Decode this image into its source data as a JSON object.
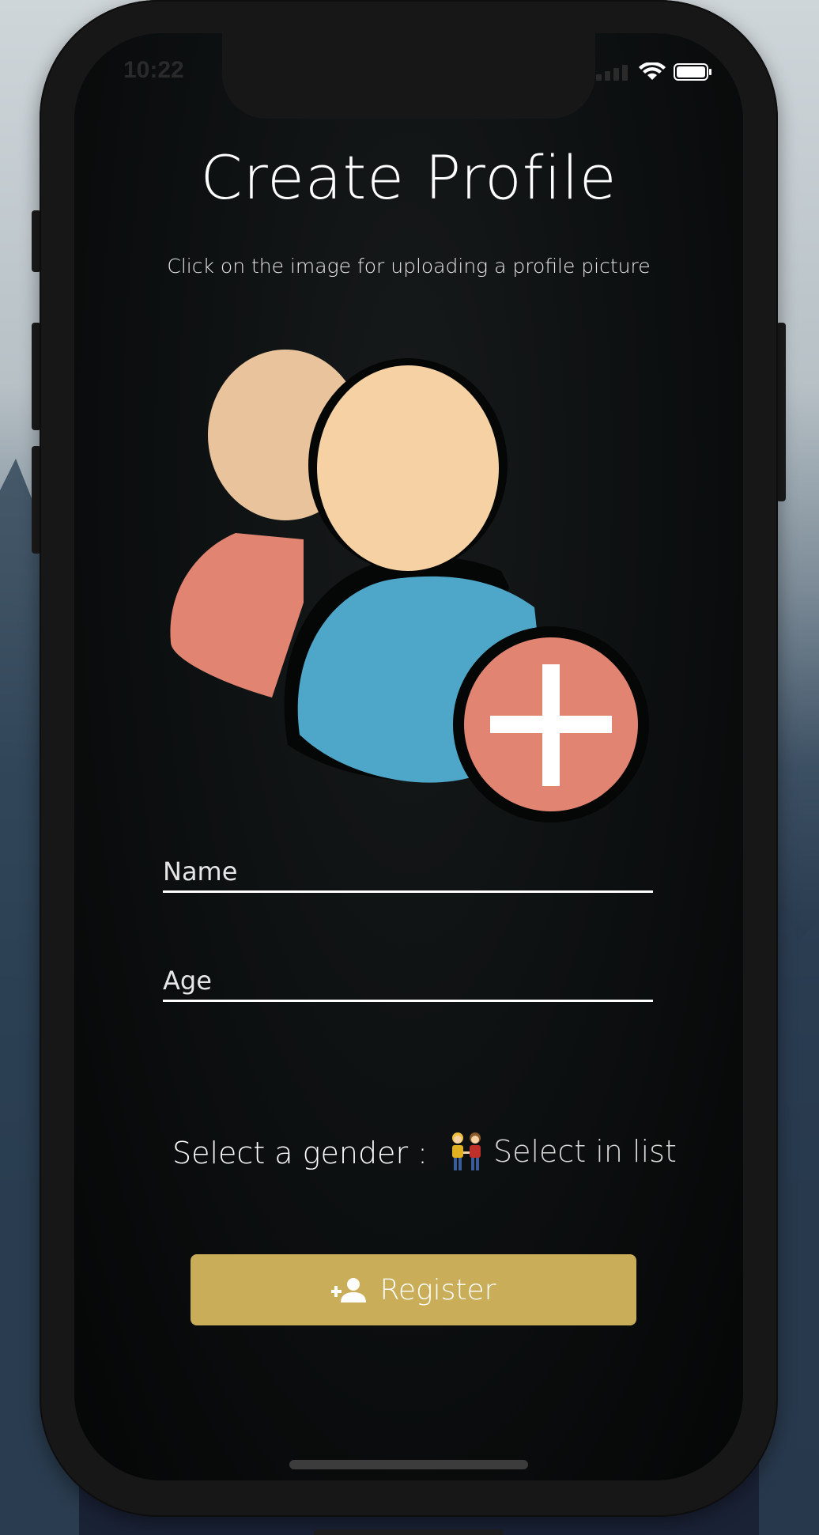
{
  "status_bar": {
    "time": "10:22"
  },
  "screen": {
    "title": "Create Profile",
    "subtitle": "Click on the image for uploading a profile picture"
  },
  "form": {
    "name_placeholder": "Name",
    "age_placeholder": "Age",
    "gender_label": "Select a gender :",
    "gender_select_icon": "couple-emoji",
    "gender_select_text": "Select in list",
    "register_label": "Register",
    "register_icon": "person-add-icon"
  },
  "colors": {
    "register_button": "#c9ad58",
    "avatar_back_person_head": "#e8c39c",
    "avatar_back_person_body": "#e28472",
    "avatar_front_person_head": "#f6d1a4",
    "avatar_front_person_body": "#4ea6c8",
    "avatar_plus_badge": "#e28472"
  }
}
